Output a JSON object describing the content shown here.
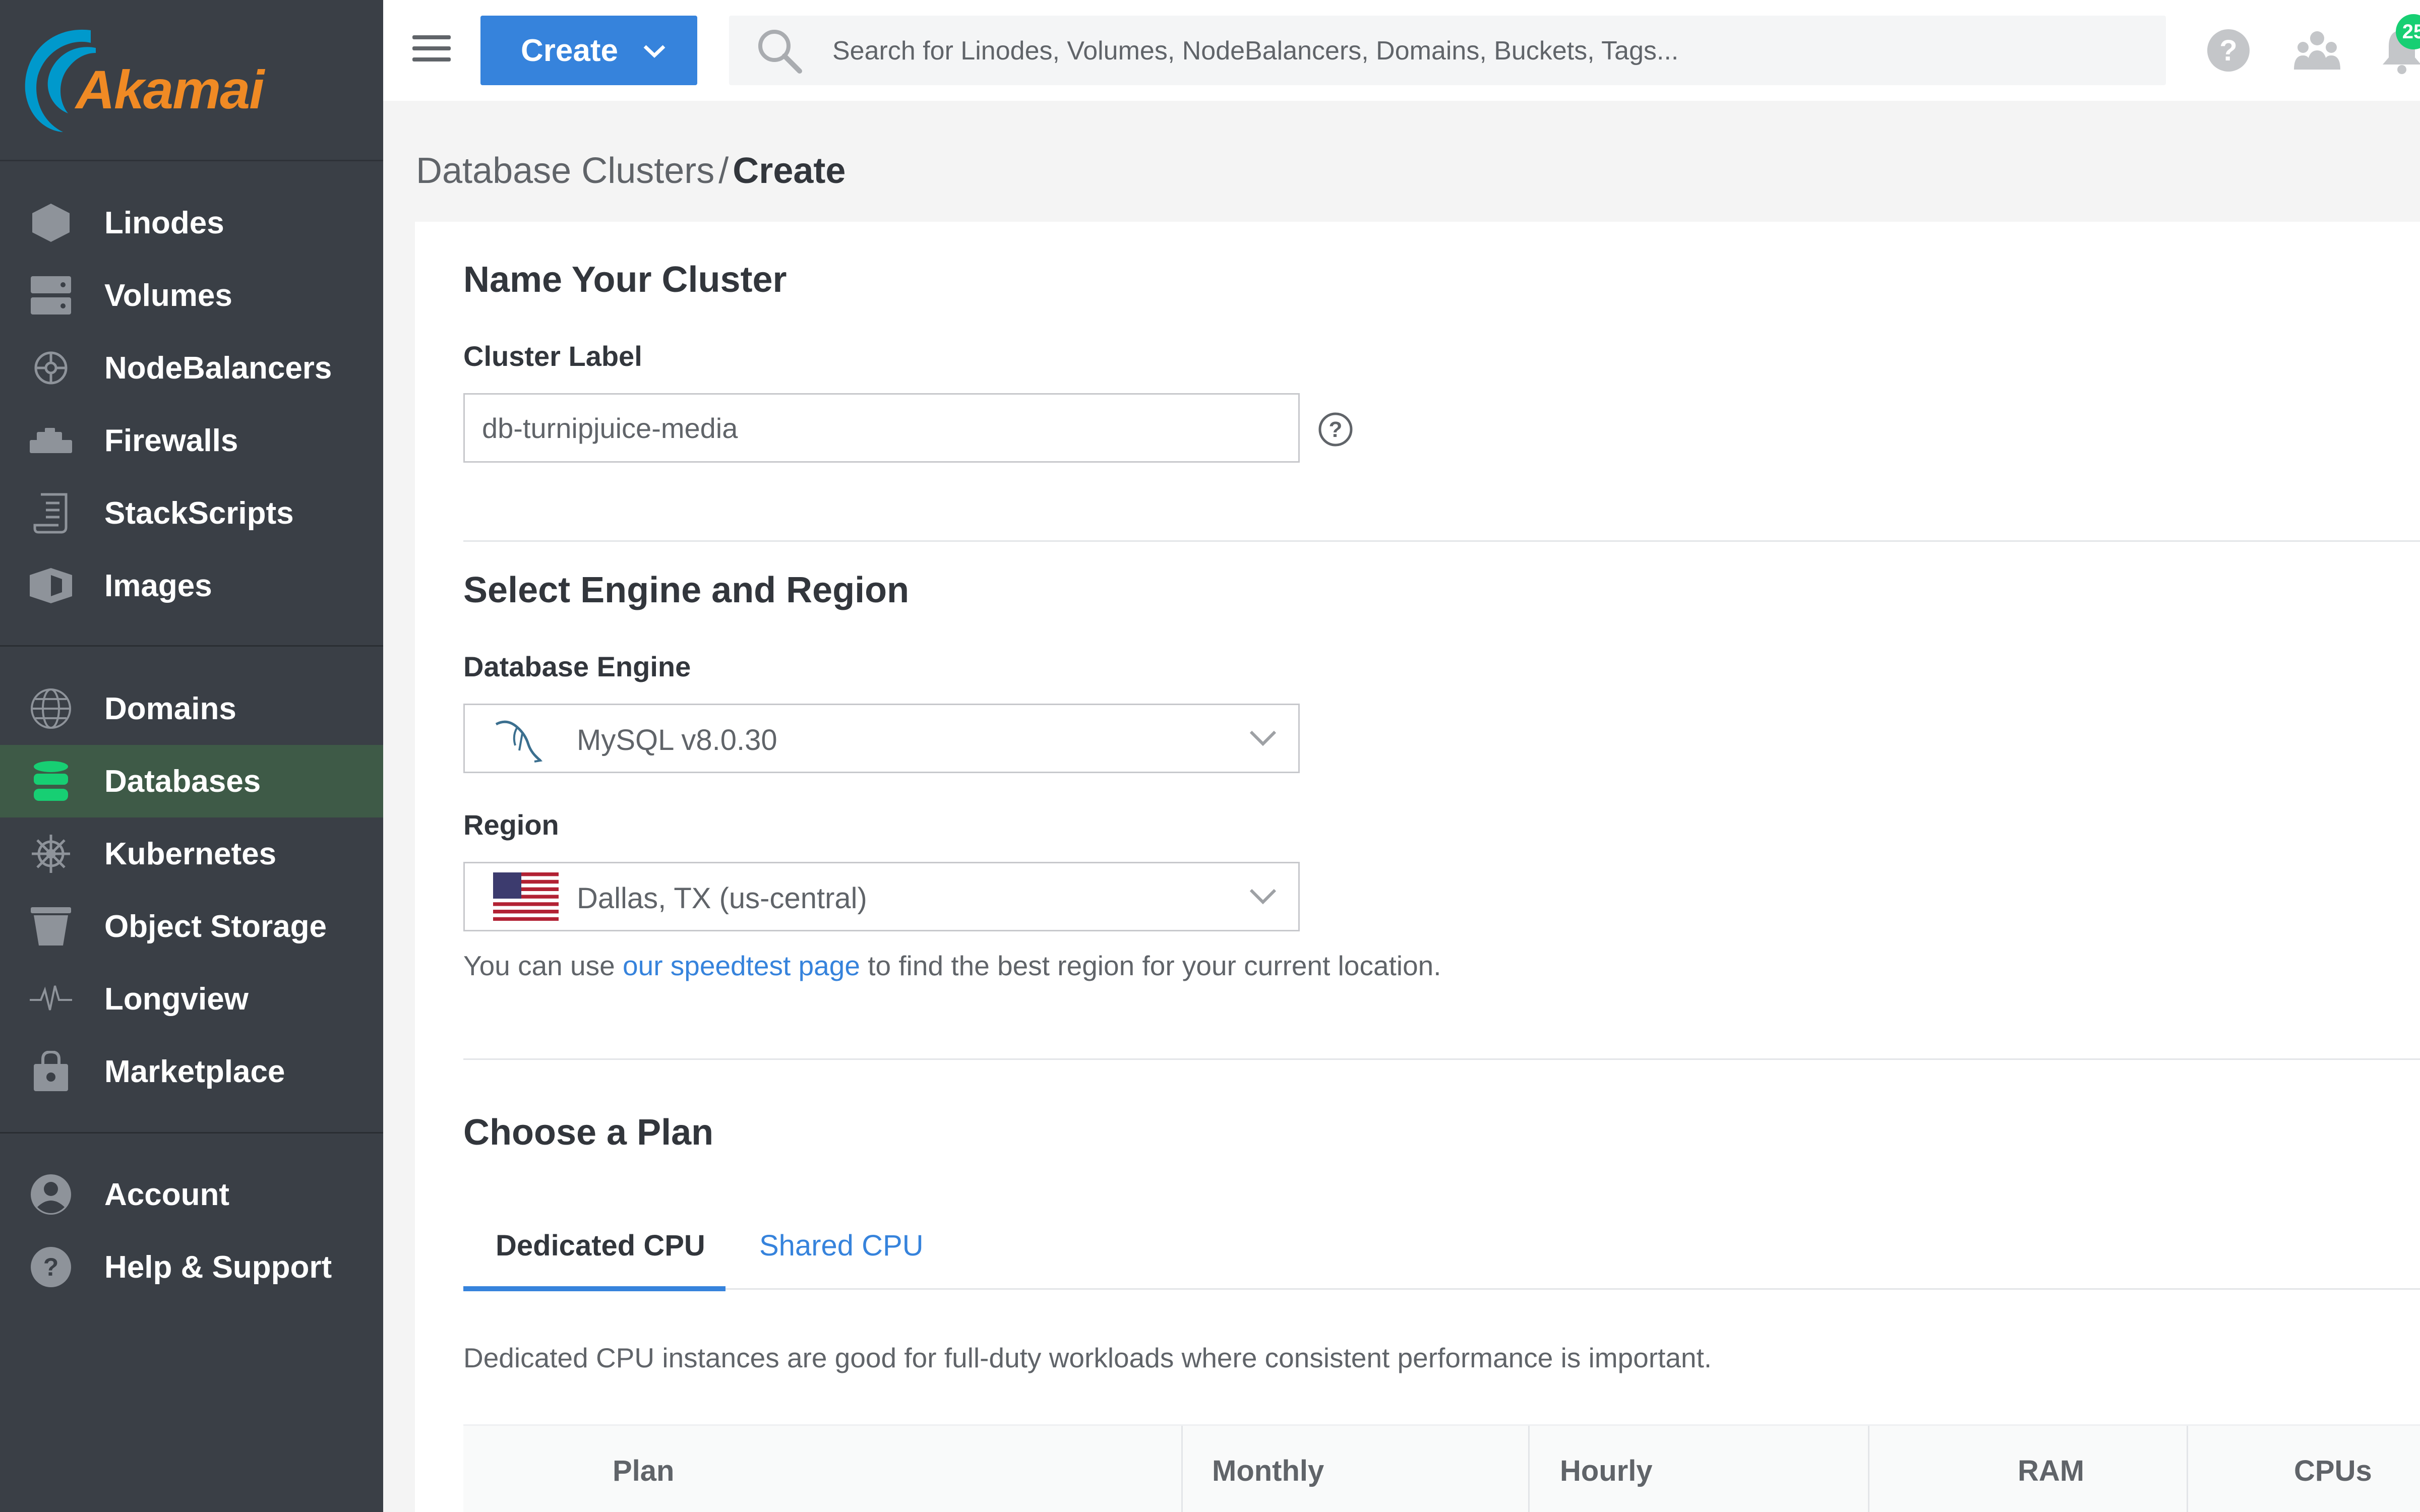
{
  "brand": {
    "name": "Akamai",
    "color": "#f08a24"
  },
  "sidebar": {
    "groups": [
      [
        {
          "label": "Linodes",
          "icon": "linode-hexagon-icon"
        },
        {
          "label": "Volumes",
          "icon": "volume-icon"
        },
        {
          "label": "NodeBalancers",
          "icon": "nodebalancer-icon"
        },
        {
          "label": "Firewalls",
          "icon": "firewall-icon"
        },
        {
          "label": "StackScripts",
          "icon": "stackscript-icon"
        },
        {
          "label": "Images",
          "icon": "image-icon"
        }
      ],
      [
        {
          "label": "Domains",
          "icon": "globe-icon"
        },
        {
          "label": "Databases",
          "icon": "database-icon",
          "active": true
        },
        {
          "label": "Kubernetes",
          "icon": "kubernetes-icon"
        },
        {
          "label": "Object Storage",
          "icon": "bucket-icon"
        },
        {
          "label": "Longview",
          "icon": "pulse-icon"
        },
        {
          "label": "Marketplace",
          "icon": "marketplace-icon"
        }
      ],
      [
        {
          "label": "Account",
          "icon": "account-icon"
        },
        {
          "label": "Help & Support",
          "icon": "help-icon"
        }
      ]
    ],
    "active_color": "#3e5a47",
    "bg_color": "#3a3f46"
  },
  "topbar": {
    "create_label": "Create",
    "search_placeholder": "Search for Linodes, Volumes, NodeBalancers, Domains, Buckets, Tags...",
    "notification_count": "25",
    "accent_color": "#3683dc"
  },
  "breadcrumb": {
    "parent": "Database Clusters",
    "separator": "/",
    "current": "Create"
  },
  "form": {
    "name_section_title": "Name Your Cluster",
    "cluster_label_label": "Cluster Label",
    "cluster_label_value": "db-turnipjuice-media",
    "engine_section_title": "Select Engine and Region",
    "engine_label": "Database Engine",
    "engine_value": "MySQL v8.0.30",
    "region_label": "Region",
    "region_value": "Dallas, TX (us-central)",
    "region_help_prefix": "You can use ",
    "region_help_link": "our speedtest page",
    "region_help_suffix": " to find the best region for your current location.",
    "plan_section_title": "Choose a Plan",
    "tabs": [
      {
        "label": "Dedicated CPU",
        "active": true
      },
      {
        "label": "Shared CPU",
        "active": false
      }
    ],
    "plan_description": "Dedicated CPU instances are good for full-duty workloads where consistent performance is important.",
    "table_headers": [
      "Plan",
      "Monthly",
      "Hourly",
      "RAM",
      "CPUs"
    ]
  }
}
